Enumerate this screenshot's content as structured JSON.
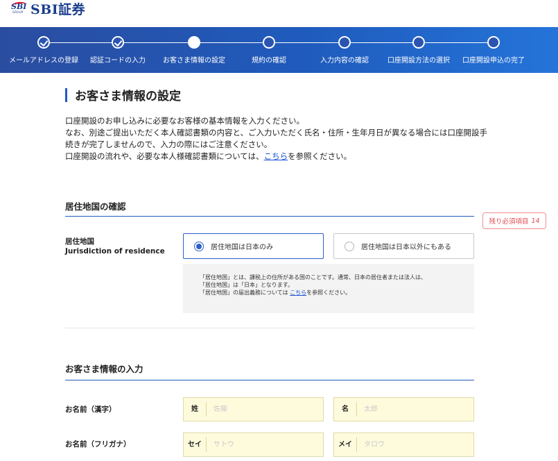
{
  "brand": {
    "mark_text": "SBI",
    "mark_sub": "GROUP",
    "name": "SBI証券",
    "accent": "#1a3e8c",
    "mark_arc_color": "#e60012"
  },
  "progress": {
    "steps": [
      {
        "label": "メールアドレスの登録",
        "state": "done"
      },
      {
        "label": "認証コードの入力",
        "state": "done"
      },
      {
        "label": "お客さま情報の設定",
        "state": "current"
      },
      {
        "label": "規約の確認",
        "state": "todo"
      },
      {
        "label": "入力内容の確認",
        "state": "todo"
      },
      {
        "label": "口座開設方法の選択",
        "state": "todo"
      },
      {
        "label": "口座開設申込の完了",
        "state": "todo"
      }
    ],
    "bar_color": "#1f5bbd"
  },
  "page": {
    "title": "お客さま情報の設定",
    "intro_line1": "口座開設のお申し込みに必要なお客様の基本情報を入力ください。",
    "intro_line2": "なお、別途ご提出いただく本人確認書類の内容と、ご入力いただく氏名・住所・生年月日が異なる場合には口座開設手",
    "intro_line3": "続きが完了しませんので、入力の際にはご注意ください。",
    "intro_line4_before": "口座開設の流れや、必要な本人様確認書類については、",
    "intro_line4_link": "こちら",
    "intro_line4_after": "を参照ください。"
  },
  "residence_section": {
    "heading": "居住地国の確認",
    "badge_label": "残り必須項目",
    "badge_count": "14",
    "field_label_ja": "居住地国",
    "field_label_en": "Jurisdiction of residence",
    "options": [
      {
        "label": "居住地国は日本のみ",
        "selected": true
      },
      {
        "label": "居住地国は日本以外にもある",
        "selected": false
      }
    ],
    "note_line1": "「居住地国」とは、課税上の住所がある国のことです。通常、日本の居住者または法人は、",
    "note_line2": "「居住地国」は「日本」となります。",
    "note_line3_before": "「居住地国」の届出義務については ",
    "note_line3_link": "こちら",
    "note_line3_after": "を参照ください。"
  },
  "customer_section": {
    "heading": "お客さま情報の入力",
    "name_kanji": {
      "label": "お名前（漢字）",
      "last_prefix": "姓",
      "last_placeholder": "佐藤",
      "first_prefix": "名",
      "first_placeholder": "太郎"
    },
    "name_kana": {
      "label": "お名前（フリガナ）",
      "last_prefix": "セイ",
      "last_placeholder": "サトウ",
      "first_prefix": "メイ",
      "first_placeholder": "タロウ"
    }
  }
}
